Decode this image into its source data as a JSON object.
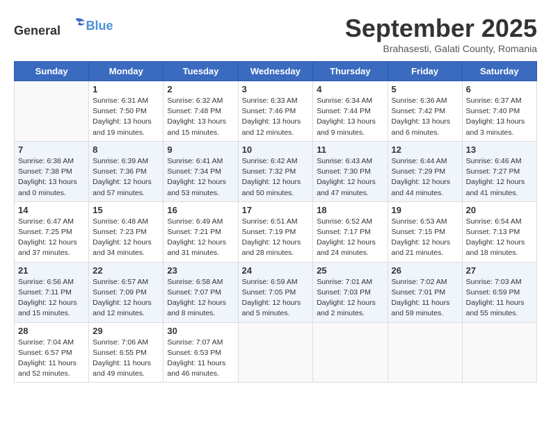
{
  "logo": {
    "general": "General",
    "blue": "Blue"
  },
  "header": {
    "month": "September 2025",
    "location": "Brahasesti, Galati County, Romania"
  },
  "weekdays": [
    "Sunday",
    "Monday",
    "Tuesday",
    "Wednesday",
    "Thursday",
    "Friday",
    "Saturday"
  ],
  "weeks": [
    [
      {
        "day": "",
        "info": ""
      },
      {
        "day": "1",
        "info": "Sunrise: 6:31 AM\nSunset: 7:50 PM\nDaylight: 13 hours\nand 19 minutes."
      },
      {
        "day": "2",
        "info": "Sunrise: 6:32 AM\nSunset: 7:48 PM\nDaylight: 13 hours\nand 15 minutes."
      },
      {
        "day": "3",
        "info": "Sunrise: 6:33 AM\nSunset: 7:46 PM\nDaylight: 13 hours\nand 12 minutes."
      },
      {
        "day": "4",
        "info": "Sunrise: 6:34 AM\nSunset: 7:44 PM\nDaylight: 13 hours\nand 9 minutes."
      },
      {
        "day": "5",
        "info": "Sunrise: 6:36 AM\nSunset: 7:42 PM\nDaylight: 13 hours\nand 6 minutes."
      },
      {
        "day": "6",
        "info": "Sunrise: 6:37 AM\nSunset: 7:40 PM\nDaylight: 13 hours\nand 3 minutes."
      }
    ],
    [
      {
        "day": "7",
        "info": "Sunrise: 6:38 AM\nSunset: 7:38 PM\nDaylight: 13 hours\nand 0 minutes."
      },
      {
        "day": "8",
        "info": "Sunrise: 6:39 AM\nSunset: 7:36 PM\nDaylight: 12 hours\nand 57 minutes."
      },
      {
        "day": "9",
        "info": "Sunrise: 6:41 AM\nSunset: 7:34 PM\nDaylight: 12 hours\nand 53 minutes."
      },
      {
        "day": "10",
        "info": "Sunrise: 6:42 AM\nSunset: 7:32 PM\nDaylight: 12 hours\nand 50 minutes."
      },
      {
        "day": "11",
        "info": "Sunrise: 6:43 AM\nSunset: 7:30 PM\nDaylight: 12 hours\nand 47 minutes."
      },
      {
        "day": "12",
        "info": "Sunrise: 6:44 AM\nSunset: 7:29 PM\nDaylight: 12 hours\nand 44 minutes."
      },
      {
        "day": "13",
        "info": "Sunrise: 6:46 AM\nSunset: 7:27 PM\nDaylight: 12 hours\nand 41 minutes."
      }
    ],
    [
      {
        "day": "14",
        "info": "Sunrise: 6:47 AM\nSunset: 7:25 PM\nDaylight: 12 hours\nand 37 minutes."
      },
      {
        "day": "15",
        "info": "Sunrise: 6:48 AM\nSunset: 7:23 PM\nDaylight: 12 hours\nand 34 minutes."
      },
      {
        "day": "16",
        "info": "Sunrise: 6:49 AM\nSunset: 7:21 PM\nDaylight: 12 hours\nand 31 minutes."
      },
      {
        "day": "17",
        "info": "Sunrise: 6:51 AM\nSunset: 7:19 PM\nDaylight: 12 hours\nand 28 minutes."
      },
      {
        "day": "18",
        "info": "Sunrise: 6:52 AM\nSunset: 7:17 PM\nDaylight: 12 hours\nand 24 minutes."
      },
      {
        "day": "19",
        "info": "Sunrise: 6:53 AM\nSunset: 7:15 PM\nDaylight: 12 hours\nand 21 minutes."
      },
      {
        "day": "20",
        "info": "Sunrise: 6:54 AM\nSunset: 7:13 PM\nDaylight: 12 hours\nand 18 minutes."
      }
    ],
    [
      {
        "day": "21",
        "info": "Sunrise: 6:56 AM\nSunset: 7:11 PM\nDaylight: 12 hours\nand 15 minutes."
      },
      {
        "day": "22",
        "info": "Sunrise: 6:57 AM\nSunset: 7:09 PM\nDaylight: 12 hours\nand 12 minutes."
      },
      {
        "day": "23",
        "info": "Sunrise: 6:58 AM\nSunset: 7:07 PM\nDaylight: 12 hours\nand 8 minutes."
      },
      {
        "day": "24",
        "info": "Sunrise: 6:59 AM\nSunset: 7:05 PM\nDaylight: 12 hours\nand 5 minutes."
      },
      {
        "day": "25",
        "info": "Sunrise: 7:01 AM\nSunset: 7:03 PM\nDaylight: 12 hours\nand 2 minutes."
      },
      {
        "day": "26",
        "info": "Sunrise: 7:02 AM\nSunset: 7:01 PM\nDaylight: 11 hours\nand 59 minutes."
      },
      {
        "day": "27",
        "info": "Sunrise: 7:03 AM\nSunset: 6:59 PM\nDaylight: 11 hours\nand 55 minutes."
      }
    ],
    [
      {
        "day": "28",
        "info": "Sunrise: 7:04 AM\nSunset: 6:57 PM\nDaylight: 11 hours\nand 52 minutes."
      },
      {
        "day": "29",
        "info": "Sunrise: 7:06 AM\nSunset: 6:55 PM\nDaylight: 11 hours\nand 49 minutes."
      },
      {
        "day": "30",
        "info": "Sunrise: 7:07 AM\nSunset: 6:53 PM\nDaylight: 11 hours\nand 46 minutes."
      },
      {
        "day": "",
        "info": ""
      },
      {
        "day": "",
        "info": ""
      },
      {
        "day": "",
        "info": ""
      },
      {
        "day": "",
        "info": ""
      }
    ]
  ]
}
